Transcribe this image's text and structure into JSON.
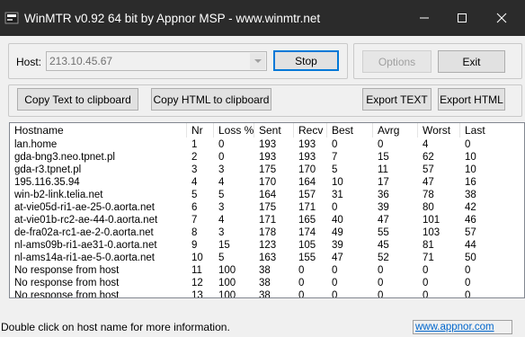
{
  "window": {
    "title": "WinMTR v0.92 64 bit by Appnor MSP - www.winmtr.net",
    "minimize_glyph": "—",
    "maximize_glyph": "☐",
    "close_glyph": "✕"
  },
  "toolbar": {
    "host_label": "Host:",
    "host_value": "213.10.45.67",
    "stop_label": "Stop",
    "options_label": "Options",
    "exit_label": "Exit",
    "copy_text_label": "Copy Text to clipboard",
    "copy_html_label": "Copy HTML to clipboard",
    "export_text_label": "Export TEXT",
    "export_html_label": "Export HTML"
  },
  "table": {
    "columns": [
      "Hostname",
      "Nr",
      "Loss %",
      "Sent",
      "Recv",
      "Best",
      "Avrg",
      "Worst",
      "Last"
    ],
    "rows": [
      [
        "lan.home",
        "1",
        "0",
        "193",
        "193",
        "0",
        "0",
        "4",
        "0"
      ],
      [
        "gda-bng3.neo.tpnet.pl",
        "2",
        "0",
        "193",
        "193",
        "7",
        "15",
        "62",
        "10"
      ],
      [
        "gda-r3.tpnet.pl",
        "3",
        "3",
        "175",
        "170",
        "5",
        "11",
        "57",
        "10"
      ],
      [
        "195.116.35.94",
        "4",
        "4",
        "170",
        "164",
        "10",
        "17",
        "47",
        "16"
      ],
      [
        "win-b2-link.telia.net",
        "5",
        "5",
        "164",
        "157",
        "31",
        "36",
        "78",
        "38"
      ],
      [
        "at-vie05d-ri1-ae-25-0.aorta.net",
        "6",
        "3",
        "175",
        "171",
        "0",
        "39",
        "80",
        "42"
      ],
      [
        "at-vie01b-rc2-ae-44-0.aorta.net",
        "7",
        "4",
        "171",
        "165",
        "40",
        "47",
        "101",
        "46"
      ],
      [
        "de-fra02a-rc1-ae-2-0.aorta.net",
        "8",
        "3",
        "178",
        "174",
        "49",
        "55",
        "103",
        "57"
      ],
      [
        "nl-ams09b-ri1-ae31-0.aorta.net",
        "9",
        "15",
        "123",
        "105",
        "39",
        "45",
        "81",
        "44"
      ],
      [
        "nl-ams14a-ri1-ae-5-0.aorta.net",
        "10",
        "5",
        "163",
        "155",
        "47",
        "52",
        "71",
        "50"
      ],
      [
        "No response from host",
        "11",
        "100",
        "38",
        "0",
        "0",
        "0",
        "0",
        "0"
      ],
      [
        "No response from host",
        "12",
        "100",
        "38",
        "0",
        "0",
        "0",
        "0",
        "0"
      ],
      [
        "No response from host",
        "13",
        "100",
        "38",
        "0",
        "0",
        "0",
        "0",
        "0"
      ]
    ]
  },
  "statusbar": {
    "message": "Double click on host name for more information.",
    "link": "www.appnor.com"
  },
  "colors": {
    "titlebar": "#2b2b2b",
    "accent": "#0078d7",
    "link": "#0066cc"
  }
}
